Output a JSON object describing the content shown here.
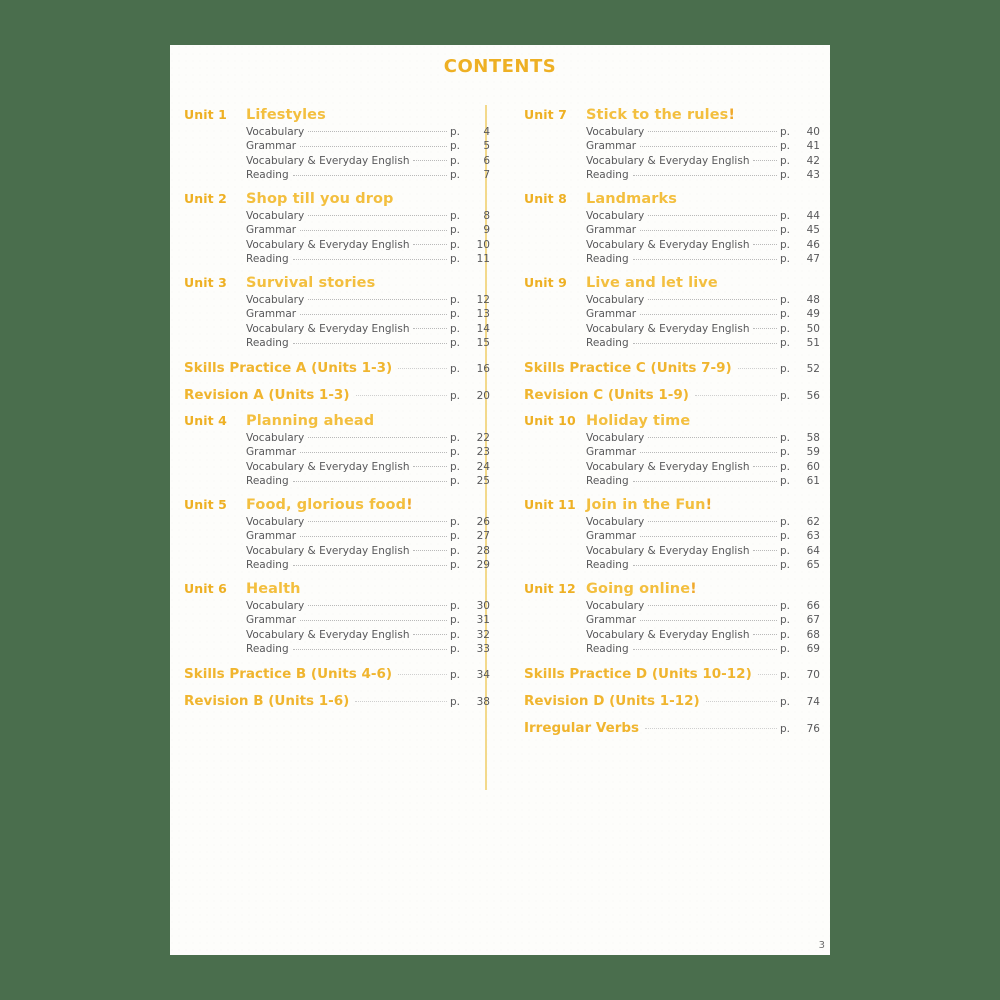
{
  "page": {
    "title": "Contents",
    "page_number": "3",
    "accent_gold": "#f0b52f",
    "accent_label": "#eeb024",
    "background_green": "#4a6e4d",
    "paper": "#fdfdfb",
    "body_text": "#58585a",
    "divider": "#f3d98b"
  },
  "sub_labels": {
    "vocabulary": "Vocabulary",
    "grammar": "Grammar",
    "vocab_everyday": "Vocabulary & Everyday English",
    "reading": "Reading",
    "p": "p."
  },
  "left_column": [
    {
      "kind": "unit",
      "label": "Unit 1",
      "title": "Lifestyles",
      "bang": "",
      "entries": [
        {
          "name": "Vocabulary",
          "p": "p.",
          "page": "4"
        },
        {
          "name": "Grammar",
          "p": "p.",
          "page": "5"
        },
        {
          "name": "Vocabulary & Everyday English",
          "p": "p.",
          "page": "6"
        },
        {
          "name": "Reading",
          "p": "p.",
          "page": "7"
        }
      ]
    },
    {
      "kind": "unit",
      "label": "Unit 2",
      "title": "Shop till you drop",
      "bang": "",
      "entries": [
        {
          "name": "Vocabulary",
          "p": "p.",
          "page": "8"
        },
        {
          "name": "Grammar",
          "p": "p.",
          "page": "9"
        },
        {
          "name": "Vocabulary & Everyday English",
          "p": "p.",
          "page": "10"
        },
        {
          "name": "Reading",
          "p": "p.",
          "page": "11"
        }
      ]
    },
    {
      "kind": "unit",
      "label": "Unit 3",
      "title": "Survival stories",
      "bang": "",
      "entries": [
        {
          "name": "Vocabulary",
          "p": "p.",
          "page": "12"
        },
        {
          "name": "Grammar",
          "p": "p.",
          "page": "13"
        },
        {
          "name": "Vocabulary & Everyday English",
          "p": "p.",
          "page": "14"
        },
        {
          "name": "Reading",
          "p": "p.",
          "page": "15"
        }
      ]
    },
    {
      "kind": "wide",
      "name": "Skills Practice A (Units 1-3)",
      "p": "p.",
      "page": "16"
    },
    {
      "kind": "wide",
      "name": "Revision A (Units 1-3)",
      "p": "p.",
      "page": "20"
    },
    {
      "kind": "unit",
      "label": "Unit 4",
      "title": "Planning ahead",
      "bang": "",
      "entries": [
        {
          "name": "Vocabulary",
          "p": "p.",
          "page": "22"
        },
        {
          "name": "Grammar",
          "p": "p.",
          "page": "23"
        },
        {
          "name": "Vocabulary & Everyday English",
          "p": "p.",
          "page": "24"
        },
        {
          "name": "Reading",
          "p": "p.",
          "page": "25"
        }
      ]
    },
    {
      "kind": "unit",
      "label": "Unit 5",
      "title": "Food, glorious food",
      "bang": "!",
      "entries": [
        {
          "name": "Vocabulary",
          "p": "p.",
          "page": "26"
        },
        {
          "name": "Grammar",
          "p": "p.",
          "page": "27"
        },
        {
          "name": "Vocabulary & Everyday English",
          "p": "p.",
          "page": "28"
        },
        {
          "name": "Reading",
          "p": "p.",
          "page": "29"
        }
      ]
    },
    {
      "kind": "unit",
      "label": "Unit 6",
      "title": "Health",
      "bang": "",
      "entries": [
        {
          "name": "Vocabulary",
          "p": "p.",
          "page": "30"
        },
        {
          "name": "Grammar",
          "p": "p.",
          "page": "31"
        },
        {
          "name": "Vocabulary & Everyday English",
          "p": "p.",
          "page": "32"
        },
        {
          "name": "Reading",
          "p": "p.",
          "page": "33"
        }
      ]
    },
    {
      "kind": "wide",
      "name": "Skills Practice B (Units 4-6)",
      "p": "p.",
      "page": "34"
    },
    {
      "kind": "wide",
      "name": "Revision B (Units 1-6)",
      "p": "p.",
      "page": "38"
    }
  ],
  "right_column": [
    {
      "kind": "unit",
      "label": "Unit 7",
      "title": "Stick to the rules",
      "bang": "!",
      "entries": [
        {
          "name": "Vocabulary",
          "p": "p.",
          "page": "40"
        },
        {
          "name": "Grammar",
          "p": "p.",
          "page": "41"
        },
        {
          "name": "Vocabulary & Everyday English",
          "p": "p.",
          "page": "42"
        },
        {
          "name": "Reading",
          "p": "p.",
          "page": "43"
        }
      ]
    },
    {
      "kind": "unit",
      "label": "Unit 8",
      "title": "Landmarks",
      "bang": "",
      "entries": [
        {
          "name": "Vocabulary",
          "p": "p.",
          "page": "44"
        },
        {
          "name": "Grammar",
          "p": "p.",
          "page": "45"
        },
        {
          "name": "Vocabulary & Everyday English",
          "p": "p.",
          "page": "46"
        },
        {
          "name": "Reading",
          "p": "p.",
          "page": "47"
        }
      ]
    },
    {
      "kind": "unit",
      "label": "Unit 9",
      "title": "Live and let live",
      "bang": "",
      "entries": [
        {
          "name": "Vocabulary",
          "p": "p.",
          "page": "48"
        },
        {
          "name": "Grammar",
          "p": "p.",
          "page": "49"
        },
        {
          "name": "Vocabulary & Everyday English",
          "p": "p.",
          "page": "50"
        },
        {
          "name": "Reading",
          "p": "p.",
          "page": "51"
        }
      ]
    },
    {
      "kind": "wide",
      "name": "Skills Practice C (Units 7-9)",
      "p": "p.",
      "page": "52"
    },
    {
      "kind": "wide",
      "name": "Revision C (Units 1-9)",
      "p": "p.",
      "page": "56"
    },
    {
      "kind": "unit",
      "label": "Unit 10",
      "title": "Holiday time",
      "bang": "",
      "entries": [
        {
          "name": "Vocabulary",
          "p": "p.",
          "page": "58"
        },
        {
          "name": "Grammar",
          "p": "p.",
          "page": "59"
        },
        {
          "name": "Vocabulary & Everyday English",
          "p": "p.",
          "page": "60"
        },
        {
          "name": "Reading",
          "p": "p.",
          "page": "61"
        }
      ]
    },
    {
      "kind": "unit",
      "label": "Unit 11",
      "title": "Join in the Fun",
      "bang": "!",
      "entries": [
        {
          "name": "Vocabulary",
          "p": "p.",
          "page": "62"
        },
        {
          "name": "Grammar",
          "p": "p.",
          "page": "63"
        },
        {
          "name": "Vocabulary & Everyday English",
          "p": "p.",
          "page": "64"
        },
        {
          "name": "Reading",
          "p": "p.",
          "page": "65"
        }
      ]
    },
    {
      "kind": "unit",
      "label": "Unit 12",
      "title": "Going online",
      "bang": "!",
      "entries": [
        {
          "name": "Vocabulary",
          "p": "p.",
          "page": "66"
        },
        {
          "name": "Grammar",
          "p": "p.",
          "page": "67"
        },
        {
          "name": "Vocabulary & Everyday English",
          "p": "p.",
          "page": "68"
        },
        {
          "name": "Reading",
          "p": "p.",
          "page": "69"
        }
      ]
    },
    {
      "kind": "wide",
      "name": "Skills Practice D (Units 10-12)",
      "p": "p.",
      "page": "70"
    },
    {
      "kind": "wide",
      "name": "Revision D (Units 1-12)",
      "p": "p.",
      "page": "74"
    },
    {
      "kind": "wide",
      "name": "Irregular Verbs",
      "p": "p.",
      "page": "76"
    }
  ]
}
